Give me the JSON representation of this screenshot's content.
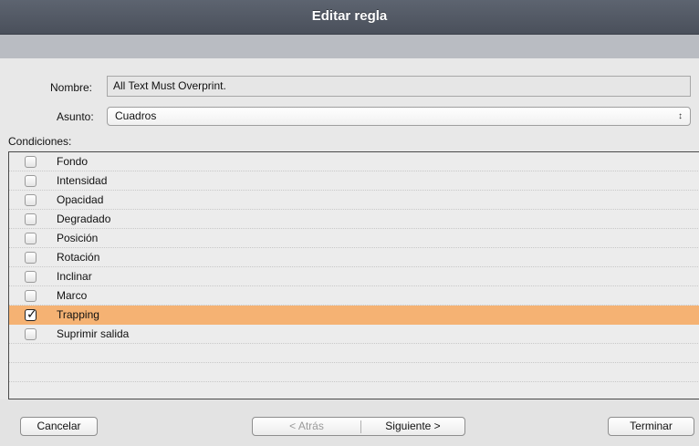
{
  "dialog": {
    "title": "Editar regla"
  },
  "form": {
    "name_label": "Nombre:",
    "name_value": "All Text Must Overprint.",
    "subject_label": "Asunto:",
    "subject_value": "Cuadros",
    "subject_arrows": "↕",
    "conditions_label": "Condiciones:"
  },
  "conditions": [
    {
      "label": "Fondo",
      "checked": false
    },
    {
      "label": "Intensidad",
      "checked": false
    },
    {
      "label": "Opacidad",
      "checked": false
    },
    {
      "label": "Degradado",
      "checked": false
    },
    {
      "label": "Posición",
      "checked": false
    },
    {
      "label": "Rotación",
      "checked": false
    },
    {
      "label": "Inclinar",
      "checked": false
    },
    {
      "label": "Marco",
      "checked": false
    },
    {
      "label": "Trapping",
      "checked": true
    },
    {
      "label": "Suprimir salida",
      "checked": false
    }
  ],
  "footer": {
    "cancel_label": "Cancelar",
    "back_label": "< Atrás",
    "next_label": "Siguiente >",
    "finish_label": "Terminar"
  },
  "colors": {
    "selection": "#f5b273",
    "titlebar": "#4f5560"
  }
}
